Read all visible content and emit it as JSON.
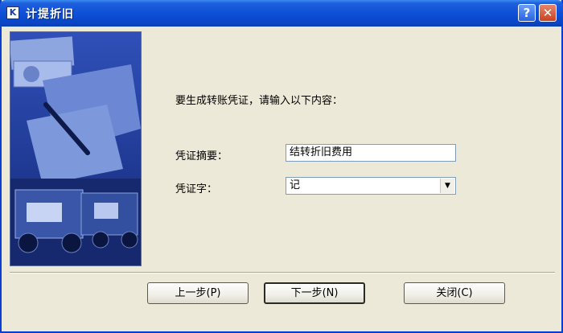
{
  "window": {
    "title": "计提折旧",
    "icon": "k3-app-icon"
  },
  "titlebar_buttons": {
    "help": "?",
    "close": "✕"
  },
  "dialog": {
    "prompt": "要生成转账凭证，请输入以下内容：",
    "summary_label": "凭证摘要：",
    "summary_value": "结转折旧费用",
    "word_label": "凭证字：",
    "word_value": "记"
  },
  "buttons": {
    "prev": "上一步(P)",
    "next": "下一步(N)",
    "close": "关闭(C)"
  },
  "colors": {
    "titlebar": "#0c4ed6",
    "dialog_bg": "#ece9d8",
    "banner": "#1f3a9a"
  }
}
